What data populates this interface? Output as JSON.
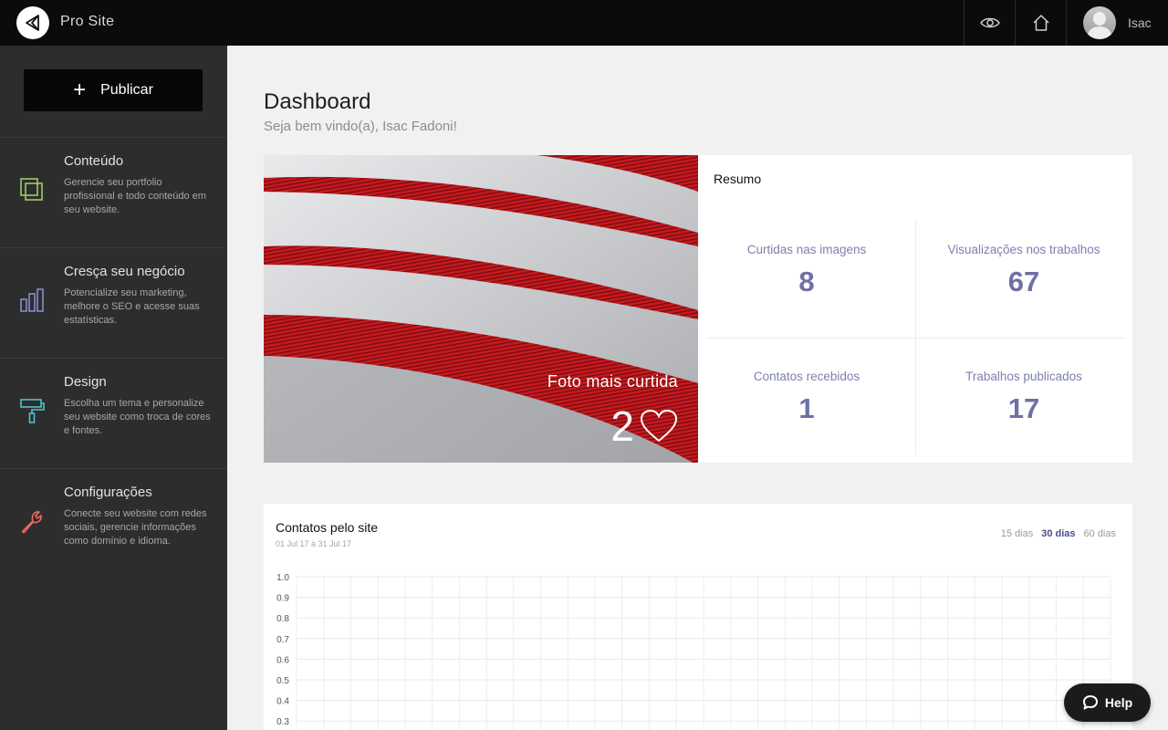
{
  "app": {
    "brand": "Pro Site",
    "user_name": "Isac"
  },
  "sidebar": {
    "publish_label": "Publicar",
    "items": [
      {
        "title": "Conteúdo",
        "desc": "Gerencie seu portfolio profissional e todo conteúdo em seu website.",
        "icon": "content-icon",
        "color": "#9ccc65"
      },
      {
        "title": "Cresça seu negócio",
        "desc": "Potencialize seu marketing, melhore o SEO e acesse suas estatísticas.",
        "icon": "bar-chart-icon",
        "color": "#8f93d6"
      },
      {
        "title": "Design",
        "desc": "Escolha um tema e personalize seu website como troca de cores e fontes.",
        "icon": "paint-roller-icon",
        "color": "#4fc3c7"
      },
      {
        "title": "Configurações",
        "desc": "Conecte seu website com redes sociais, gerencie informações como domínio e idioma.",
        "icon": "wrench-icon",
        "color": "#ef6a5a"
      }
    ]
  },
  "main": {
    "title": "Dashboard",
    "subtitle": "Seja bem vindo(a), Isac Fadoni!",
    "photo": {
      "label": "Foto mais curtida",
      "count": "2"
    },
    "summary": {
      "title": "Resumo",
      "stats": [
        {
          "label": "Curtidas nas imagens",
          "value": "8"
        },
        {
          "label": "Visualizações nos trabalhos",
          "value": "67"
        },
        {
          "label": "Contatos recebidos",
          "value": "1"
        },
        {
          "label": "Trabalhos publicados",
          "value": "17"
        }
      ]
    },
    "contacts_chart": {
      "title": "Contatos pelo site",
      "range": "01 Jul 17 à 31 Jul 17",
      "filters": [
        "15 dias",
        "30 dias",
        "60 dias"
      ],
      "active_filter": "30 dias"
    }
  },
  "help_label": "Help",
  "chart_data": {
    "type": "line",
    "title": "Contatos pelo site",
    "y_ticks": [
      "1.0",
      "0.9",
      "0.8",
      "0.7",
      "0.6",
      "0.5",
      "0.4",
      "0.3"
    ],
    "ylim": [
      0,
      1
    ],
    "grid": true,
    "series": []
  }
}
